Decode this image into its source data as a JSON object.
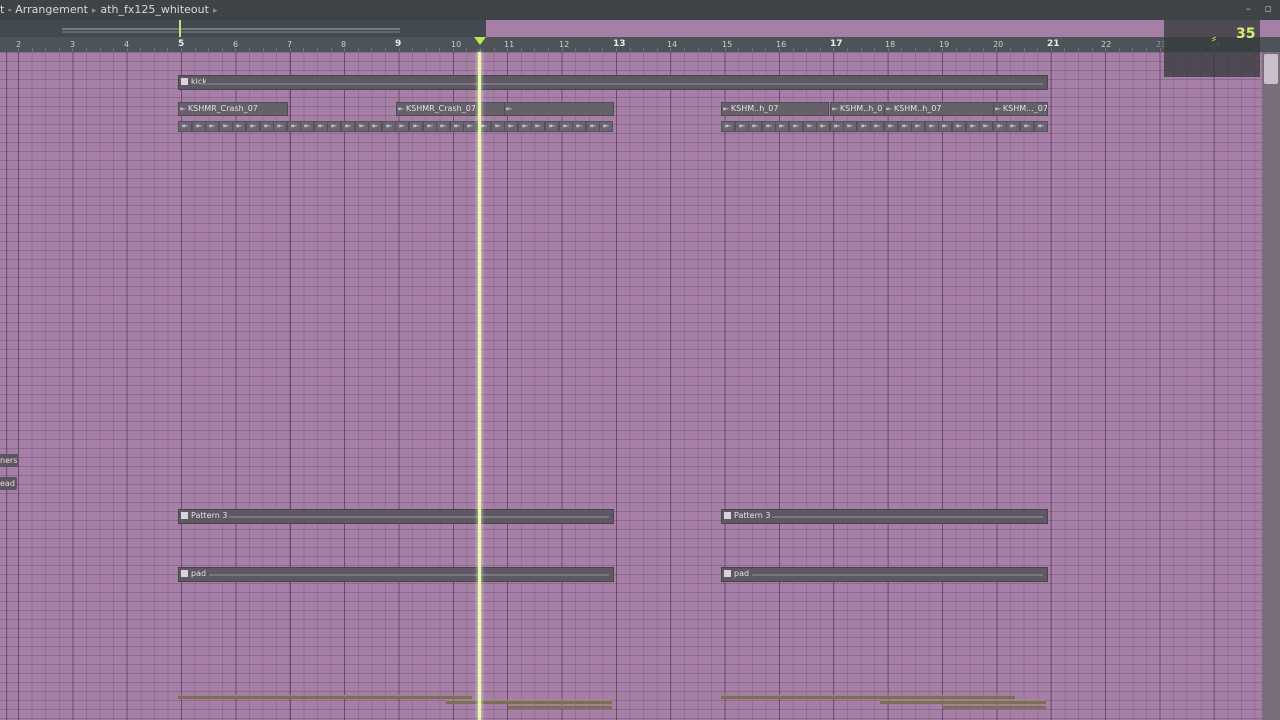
{
  "titlebar": {
    "crumbs": [
      "t - Arrangement",
      "ath_fx125_whiteout"
    ],
    "separator": "▸"
  },
  "window_controls": {
    "minimize": "–",
    "maximize": "▫"
  },
  "ruler": {
    "bars": [
      "2",
      "3",
      "4",
      "5",
      "6",
      "7",
      "8",
      "9",
      "10",
      "11",
      "12",
      "13",
      "14",
      "15",
      "16",
      "17",
      "18",
      "19",
      "20",
      "21",
      "22",
      "23",
      "24"
    ],
    "major_bars": [
      "5",
      "9",
      "13",
      "17",
      "21"
    ]
  },
  "tempo": {
    "value": "35",
    "icon": "metronome-icon"
  },
  "clips": {
    "kick": "kick",
    "crash_1": "KSHMR_Crash_07",
    "crash_2": "KSHMR_Crash_07",
    "hat_1": "KSHM..h_07",
    "hat_2": "KSHM..h_07",
    "hat_3": "KSHM..h_07",
    "hat_4": "KSHM..._07",
    "pattern3_a": "Pattern 3",
    "pattern3_b": "Pattern 3",
    "pad_a": "pad",
    "pad_b": "pad"
  },
  "side_labels": {
    "label_1": "ners",
    "label_2": "ead"
  },
  "colors": {
    "grid_bg": "#a67fa6",
    "playhead": "#e9f7b2",
    "accent": "#d6ef69"
  },
  "playhead_bar": 10.5
}
